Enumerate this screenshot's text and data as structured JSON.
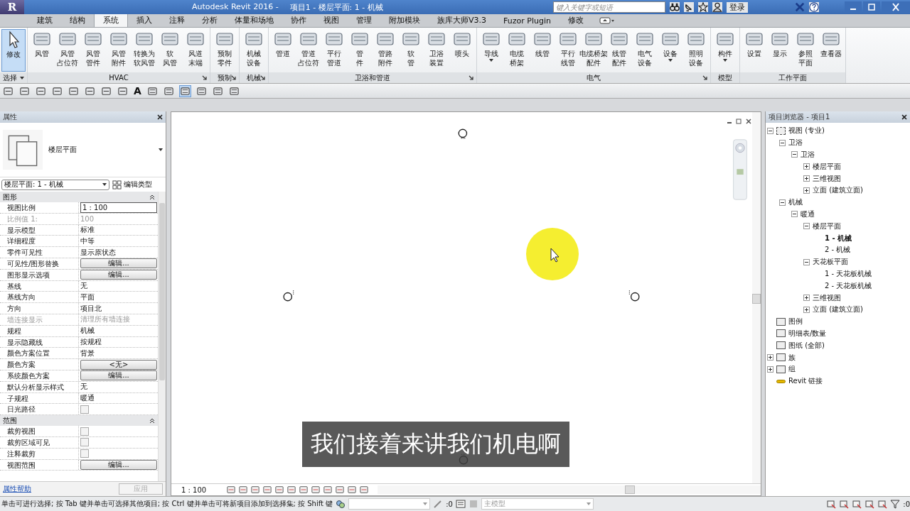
{
  "window": {
    "logo": "R",
    "app_title": "Autodesk Revit 2016 -",
    "doc_title": "项目1 - 楼层平面: 1 - 机械",
    "search": {
      "placeholder": "键入关键字或短语"
    },
    "login": "登录"
  },
  "tabs": [
    {
      "label": "建筑",
      "selected": false
    },
    {
      "label": "结构",
      "selected": false
    },
    {
      "label": "系统",
      "selected": true
    },
    {
      "label": "插入",
      "selected": false
    },
    {
      "label": "注释",
      "selected": false
    },
    {
      "label": "分析",
      "selected": false
    },
    {
      "label": "体量和场地",
      "selected": false
    },
    {
      "label": "协作",
      "selected": false
    },
    {
      "label": "视图",
      "selected": false
    },
    {
      "label": "管理",
      "selected": false
    },
    {
      "label": "附加模块",
      "selected": false
    },
    {
      "label": "族库大师V3.3",
      "selected": false
    },
    {
      "label": "Fuzor Plugin",
      "selected": false
    },
    {
      "label": "修改",
      "selected": false
    }
  ],
  "ribbon": [
    {
      "label": "选择",
      "kind": "select",
      "launcher": false,
      "tools": [
        {
          "label": "修改",
          "dropdown": false
        }
      ]
    },
    {
      "label": "HVAC",
      "kind": "tools",
      "launcher": true,
      "tools": [
        {
          "label": "风管",
          "dropdown": false
        },
        {
          "lines": [
            "风管",
            "占位符"
          ],
          "dropdown": false
        },
        {
          "lines": [
            "风管",
            "管件"
          ],
          "dropdown": false
        },
        {
          "lines": [
            "风管",
            "附件"
          ],
          "dropdown": false
        },
        {
          "lines": [
            "转换为",
            "软风管"
          ],
          "dropdown": false
        },
        {
          "lines": [
            "软",
            "风管"
          ],
          "dropdown": false
        },
        {
          "lines": [
            "风道",
            "末端"
          ],
          "dropdown": false
        }
      ]
    },
    {
      "label": "预制",
      "kind": "tools",
      "launcher": true,
      "tools": [
        {
          "lines": [
            "预制",
            "零件"
          ],
          "dropdown": false
        }
      ]
    },
    {
      "label": "机械",
      "kind": "tools",
      "launcher": true,
      "tools": [
        {
          "lines": [
            "机械",
            "设备"
          ],
          "dropdown": false
        }
      ]
    },
    {
      "label": "卫浴和管道",
      "kind": "tools",
      "launcher": true,
      "tools": [
        {
          "label": "管道",
          "dropdown": false
        },
        {
          "lines": [
            "管道",
            "占位符"
          ],
          "dropdown": false
        },
        {
          "lines": [
            "平行",
            "管道"
          ],
          "dropdown": false
        },
        {
          "lines": [
            "管",
            "件"
          ],
          "dropdown": false
        },
        {
          "lines": [
            "管路",
            "附件"
          ],
          "dropdown": false
        },
        {
          "lines": [
            "软",
            "管"
          ],
          "dropdown": false
        },
        {
          "lines": [
            "卫浴",
            "装置"
          ],
          "dropdown": false
        },
        {
          "label": "喷头",
          "dropdown": false
        }
      ]
    },
    {
      "label": "电气",
      "kind": "tools",
      "launcher": true,
      "tools": [
        {
          "label": "导线",
          "dropdown": true
        },
        {
          "lines": [
            "电缆",
            "桥架"
          ],
          "dropdown": false
        },
        {
          "label": "线管",
          "dropdown": false
        },
        {
          "lines": [
            "平行",
            "线管"
          ],
          "dropdown": false
        },
        {
          "lines": [
            "电缆桥架",
            "配件"
          ],
          "dropdown": false
        },
        {
          "lines": [
            "线管",
            "配件"
          ],
          "dropdown": false
        },
        {
          "lines": [
            "电气",
            "设备"
          ],
          "dropdown": false
        },
        {
          "label": "设备",
          "dropdown": true
        },
        {
          "lines": [
            "照明",
            "设备"
          ],
          "dropdown": false
        }
      ]
    },
    {
      "label": "模型",
      "kind": "tools",
      "launcher": false,
      "tools": [
        {
          "label": "构件",
          "dropdown": true
        }
      ]
    },
    {
      "label": "工作平面",
      "kind": "tools",
      "launcher": false,
      "tools": [
        {
          "label": "设置",
          "dropdown": false
        },
        {
          "label": "显示",
          "dropdown": false
        },
        {
          "lines": [
            "参照",
            "平面"
          ],
          "dropdown": false
        },
        {
          "label": "查看器",
          "dropdown": false
        }
      ]
    }
  ],
  "quick_access": {
    "text_tool": "A"
  },
  "properties": {
    "title": "属性",
    "type_name": "楼层平面",
    "selector": "楼层平面: 1 - 机械",
    "edit_type": "编辑类型",
    "sections": [
      {
        "title": "图形",
        "rows": [
          {
            "name": "视图比例",
            "value": "1 : 100",
            "kind": "field",
            "disabled": false
          },
          {
            "name": "比例值 1:",
            "value": "100",
            "kind": "text",
            "disabled": true
          },
          {
            "name": "显示模型",
            "value": "标准",
            "kind": "text",
            "disabled": false
          },
          {
            "name": "详细程度",
            "value": "中等",
            "kind": "text",
            "disabled": false
          },
          {
            "name": "零件可见性",
            "value": "显示原状态",
            "kind": "text",
            "disabled": false
          },
          {
            "name": "可见性/图形替换",
            "value": "编辑...",
            "kind": "button",
            "disabled": false
          },
          {
            "name": "图形显示选项",
            "value": "编辑...",
            "kind": "button",
            "disabled": false
          },
          {
            "name": "基线",
            "value": "无",
            "kind": "text",
            "disabled": false
          },
          {
            "name": "基线方向",
            "value": "平面",
            "kind": "text",
            "disabled": false
          },
          {
            "name": "方向",
            "value": "项目北",
            "kind": "text",
            "disabled": false
          },
          {
            "name": "墙连接显示",
            "value": "清理所有墙连接",
            "kind": "text",
            "disabled": true
          },
          {
            "name": "规程",
            "value": "机械",
            "kind": "text",
            "disabled": false
          },
          {
            "name": "显示隐藏线",
            "value": "按规程",
            "kind": "text",
            "disabled": false
          },
          {
            "name": "颜色方案位置",
            "value": "背景",
            "kind": "text",
            "disabled": false
          },
          {
            "name": "颜色方案",
            "value": "<无>",
            "kind": "button",
            "disabled": false
          },
          {
            "name": "系统颜色方案",
            "value": "编辑...",
            "kind": "button",
            "disabled": false
          },
          {
            "name": "默认分析显示样式",
            "value": "无",
            "kind": "text",
            "disabled": false
          },
          {
            "name": "子规程",
            "value": "暖通",
            "kind": "text",
            "disabled": false
          },
          {
            "name": "日光路径",
            "kind": "checkbox",
            "checked": false,
            "disabled": false
          }
        ]
      },
      {
        "title": "范围",
        "rows": [
          {
            "name": "裁剪视图",
            "kind": "checkbox",
            "checked": false,
            "disabled": false
          },
          {
            "name": "裁剪区域可见",
            "kind": "checkbox",
            "checked": false,
            "disabled": false
          },
          {
            "name": "注释裁剪",
            "kind": "checkbox",
            "checked": false,
            "disabled": false
          },
          {
            "name": "视图范围",
            "value": "编辑...",
            "kind": "button",
            "disabled": false
          }
        ]
      }
    ],
    "help_link": "属性帮助",
    "apply_button": {
      "label": "应用",
      "disabled": true
    }
  },
  "canvas": {
    "subtitle": "我们接着来讲我们机电啊"
  },
  "view_bar": {
    "scale": "1 : 100"
  },
  "project_browser": {
    "title": "项目浏览器 - 项目1",
    "tree": [
      {
        "label": "视图 (专业)",
        "kind": "views",
        "expanded": true,
        "children": [
          {
            "label": "卫浴",
            "expanded": true,
            "children": [
              {
                "label": "卫浴",
                "expanded": true,
                "children": [
                  {
                    "label": "楼层平面",
                    "expanded": false
                  },
                  {
                    "label": "三维视图",
                    "expanded": false
                  },
                  {
                    "label": "立面 (建筑立面)",
                    "expanded": false
                  }
                ]
              }
            ]
          },
          {
            "label": "机械",
            "expanded": true,
            "children": [
              {
                "label": "暖通",
                "expanded": true,
                "children": [
                  {
                    "label": "楼层平面",
                    "expanded": true,
                    "children": [
                      {
                        "label": "1 - 机械",
                        "active": true
                      },
                      {
                        "label": "2 - 机械",
                        "active": false
                      }
                    ]
                  },
                  {
                    "label": "天花板平面",
                    "expanded": true,
                    "children": [
                      {
                        "label": "1 - 天花板机械",
                        "active": false
                      },
                      {
                        "label": "2 - 天花板机械",
                        "active": false
                      }
                    ]
                  },
                  {
                    "label": "三维视图",
                    "expanded": false
                  },
                  {
                    "label": "立面 (建筑立面)",
                    "expanded": false
                  }
                ]
              }
            ]
          }
        ]
      },
      {
        "label": "图例",
        "kind": "legend"
      },
      {
        "label": "明细表/数量",
        "kind": "schedule"
      },
      {
        "label": "图纸 (全部)",
        "kind": "sheet"
      },
      {
        "label": "族",
        "kind": "family",
        "expanded": false
      },
      {
        "label": "组",
        "kind": "group",
        "expanded": false
      },
      {
        "label": "Revit 链接",
        "kind": "link"
      }
    ]
  },
  "status_bar": {
    "message": "单击可进行选择; 按 Tab 键并单击可选择其他项目; 按 Ctrl 键并单击可将新项目添加到选择集; 按 Shift 键",
    "worksets_count": ":0",
    "model": "主模型",
    "filter_count": ":0"
  }
}
